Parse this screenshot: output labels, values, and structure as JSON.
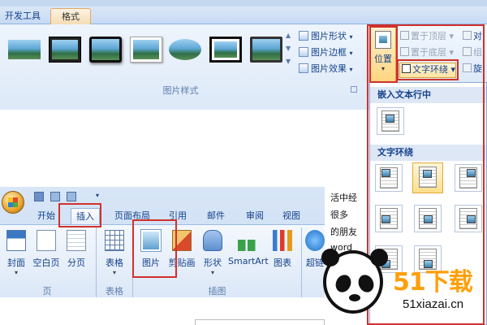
{
  "top_ribbon": {
    "tabs": [
      "开发工具",
      "格式"
    ],
    "picture_styles": {
      "label": "图片样式",
      "commands": [
        "图片形状",
        "图片边框",
        "图片效果"
      ]
    }
  },
  "arrange": {
    "position_label": "位置",
    "bring_front": "置于顶层",
    "send_back": "置于底层",
    "text_wrap": "文字环绕",
    "align_partial": "对",
    "group_partial": "组",
    "rotate_partial": "旋"
  },
  "position_dropdown": {
    "inline_header": "嵌入文本行中",
    "wrap_header": "文字环绕"
  },
  "lower_ribbon": {
    "tabs": [
      "开始",
      "插入",
      "页面布局",
      "引用",
      "邮件",
      "审阅",
      "视图"
    ],
    "buttons": {
      "cover": "封面",
      "blank": "空白页",
      "page_break": "分页",
      "table": "表格",
      "picture": "图片",
      "clipart": "剪贴画",
      "shapes": "形状",
      "smartart": "SmartArt",
      "chart": "图表",
      "hyperlink": "超链"
    },
    "groups": {
      "pages": "页",
      "tables": "表格",
      "illustrations": "插图"
    }
  },
  "doc_text": [
    "活中经",
    "很多",
    "的朋友",
    "word"
  ],
  "watermark": {
    "brand": "51下载",
    "url": "51xiazai.cn"
  }
}
